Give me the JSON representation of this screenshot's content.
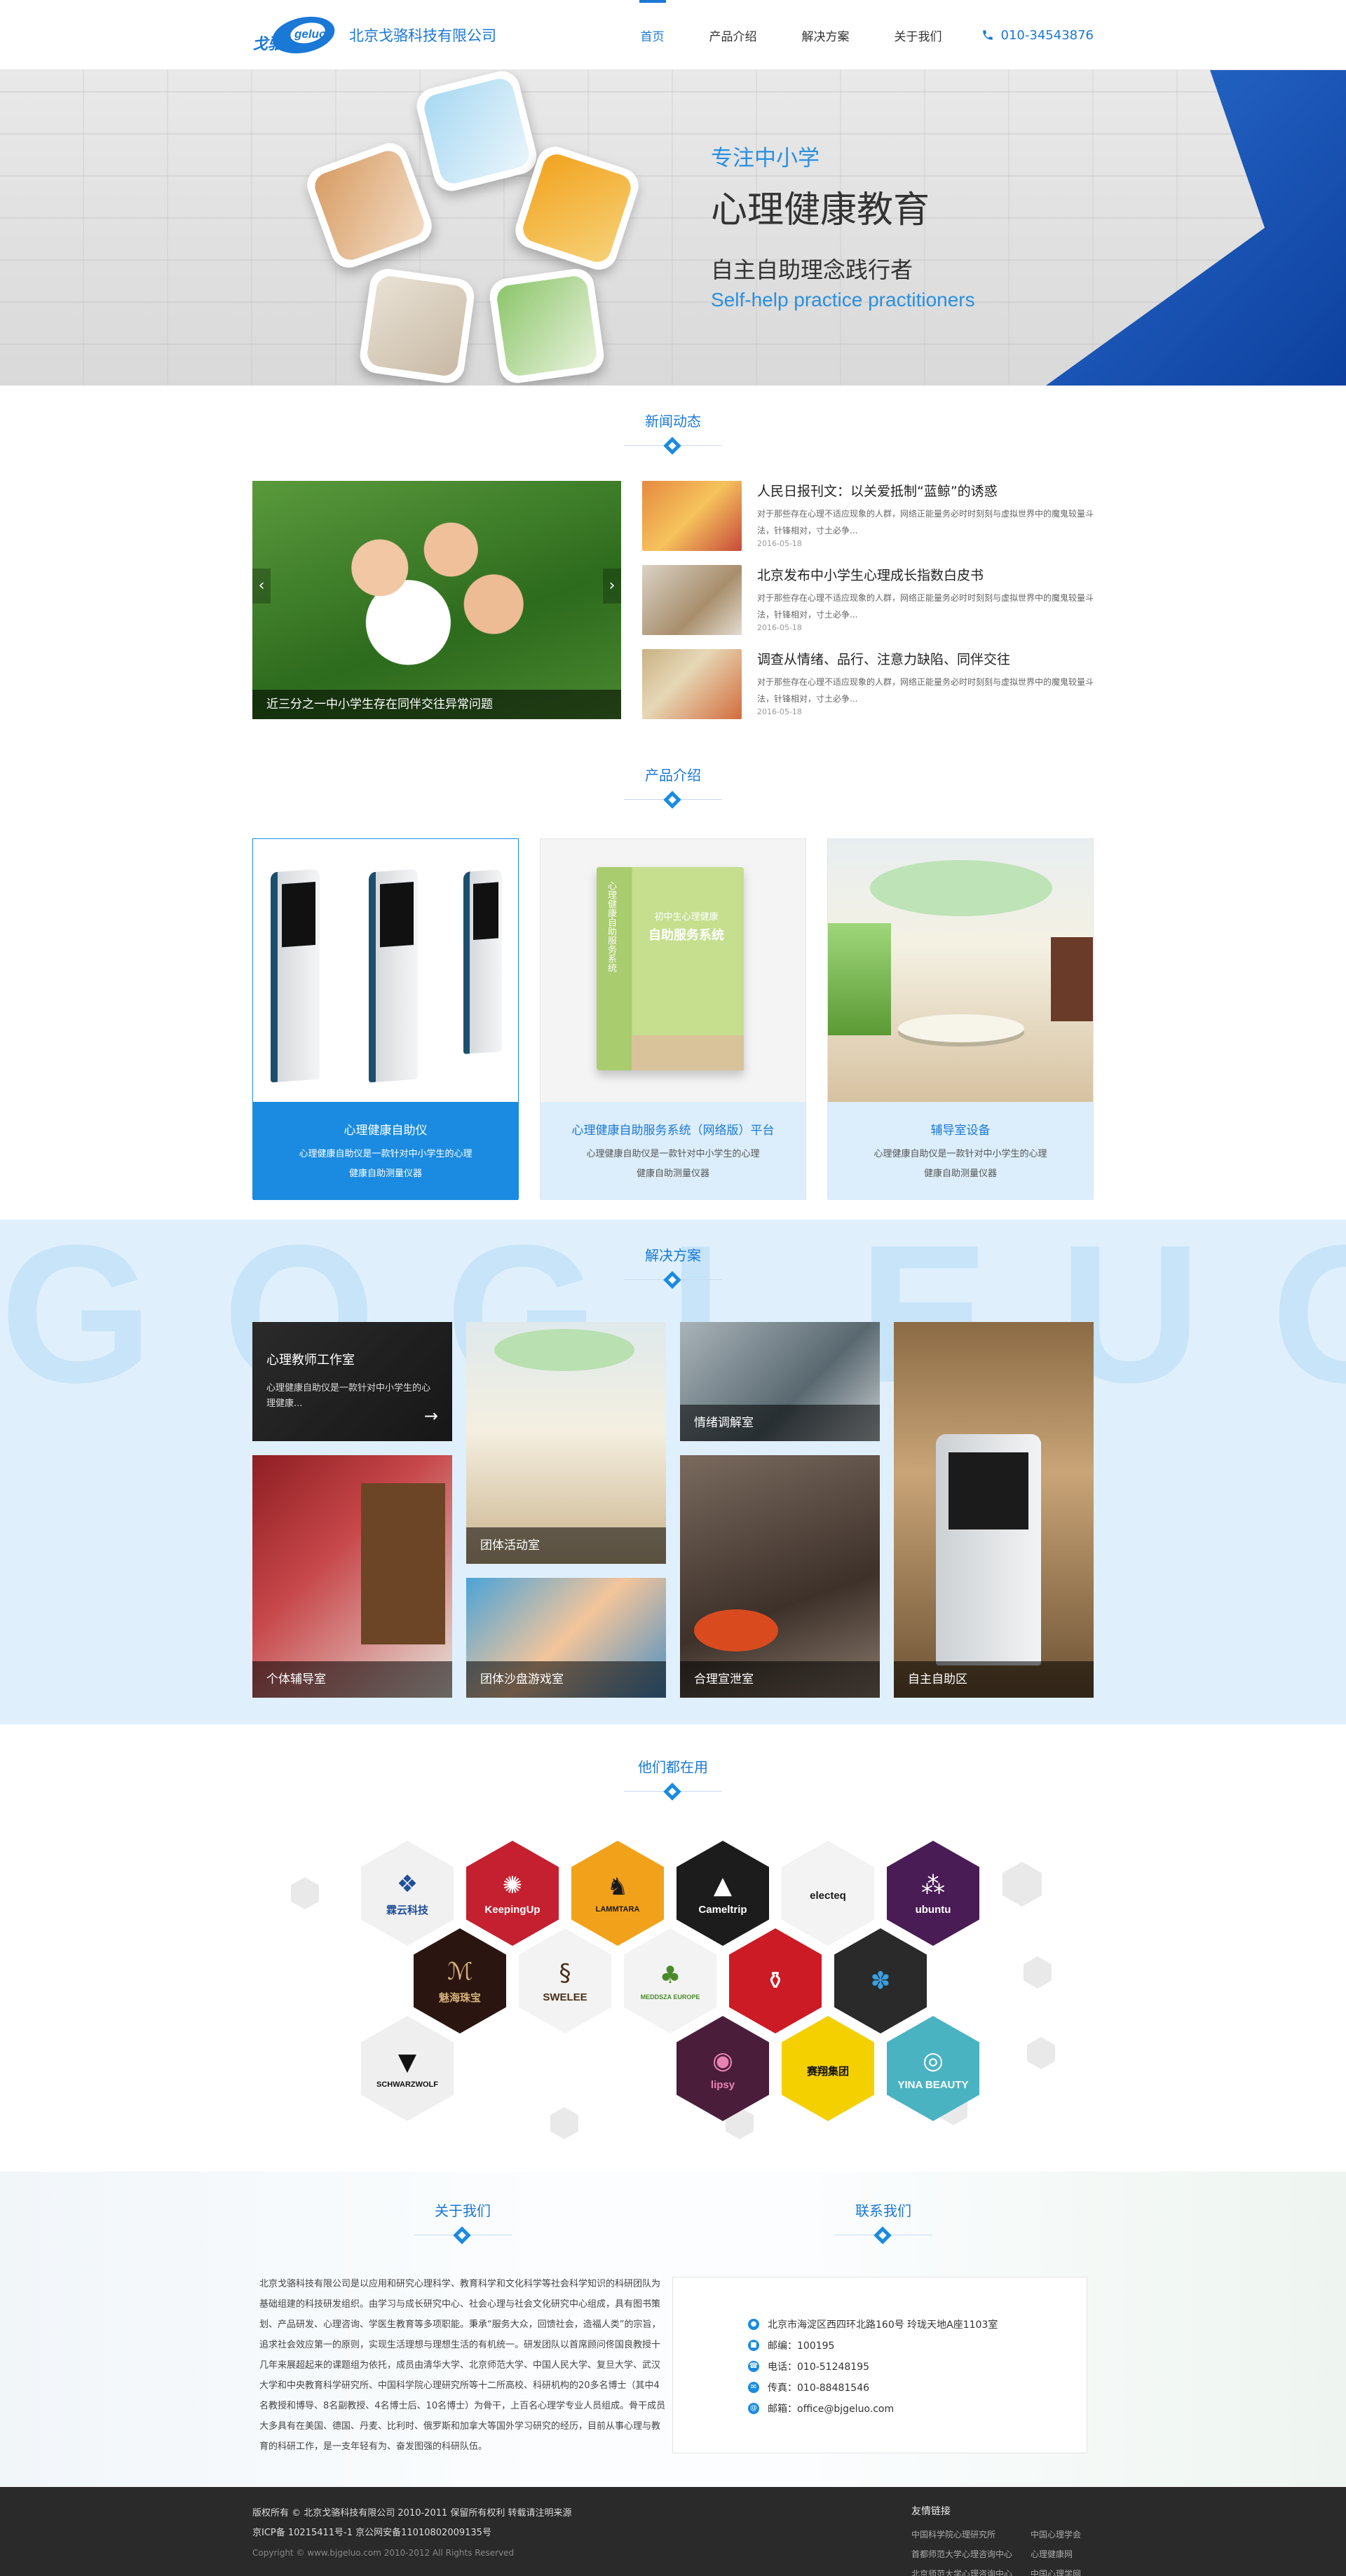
{
  "header": {
    "logo_text": "戈骆",
    "logo_latin": "geluo",
    "company": "北京戈骆科技有限公司",
    "nav": [
      "首页",
      "产品介绍",
      "解决方案",
      "关于我们"
    ],
    "phone": "010-34543876"
  },
  "banner": {
    "line1": "专注中小学",
    "line2": "心理健康教育",
    "line3": "自主自助理念践行者",
    "line4": "Self-help practice practitioners"
  },
  "news": {
    "title": "新闻动态",
    "slider_caption": "近三分之一中小学生存在同伴交往异常问题",
    "items": [
      {
        "title": "人民日报刊文：以关爱抵制“蓝鲸”的诱惑",
        "desc": "对于那些存在心理不适应现象的人群，网络正能量务必时时刻刻与虚拟世界中的魔鬼较量斗法，针锋相对，寸土必争...",
        "date": "2016-05-18"
      },
      {
        "title": "北京发布中小学生心理成长指数白皮书",
        "desc": "对于那些存在心理不适应现象的人群，网络正能量务必时时刻刻与虚拟世界中的魔鬼较量斗法，针锋相对，寸土必争...",
        "date": "2016-05-18"
      },
      {
        "title": "调查从情绪、品行、注意力缺陷、同伴交往",
        "desc": "对于那些存在心理不适应现象的人群，网络正能量务必时时刻刻与虚拟世界中的魔鬼较量斗法，针锋相对，寸土必争...",
        "date": "2016-05-18"
      }
    ]
  },
  "products": {
    "title": "产品介绍",
    "items": [
      {
        "name": "心理健康自助仪",
        "desc": "心理健康自助仪是一款针对中小学生的心理健康自助测量仪器"
      },
      {
        "name": "心理健康自助服务系统（网络版）平台",
        "desc": "心理健康自助仪是一款针对中小学生的心理健康自助测量仪器"
      },
      {
        "name": "辅导室设备",
        "desc": "心理健康自助仪是一款针对中小学生的心理健康自助测量仪器"
      }
    ],
    "box_title": "初中生心理健康",
    "box_sub": "自助服务系统",
    "box_side": "心理健康自助服务系统"
  },
  "solutions": {
    "title": "解决方案",
    "bg_letters": "GOGLEUO",
    "feature": {
      "name": "心理教师工作室",
      "desc": "心理健康自助仪是一款针对中小学生的心理健康..."
    },
    "labels": [
      "情绪调解室",
      "团体活动室",
      "个体辅导室",
      "团体沙盘游戏室",
      "合理宣泄室",
      "自主自助区"
    ]
  },
  "clients": {
    "title": "他们都在用",
    "brands": [
      "霖云科技",
      "KeepingUp",
      "LAMMTARA",
      "Cameltrip",
      "electeq",
      "ubuntu",
      "魅海珠宝",
      "SWELEE",
      "MEDDSZA EUROPE",
      "",
      "",
      "SCHWARZWOLF",
      "lipsy",
      "赛翔集团",
      "YINA BEAUTY"
    ]
  },
  "about": {
    "title": "关于我们",
    "text": "北京戈骆科技有限公司是以应用和研究心理科学、教育科学和文化科学等社会科学知识的科研团队为基础组建的科技研发组织。由学习与成长研究中心、社会心理与社会文化研究中心组成，具有图书策划、产品研发、心理咨询、学医生教育等多项职能。秉承“服务大众，回馈社会，造福人类”的宗旨，追求社会效应第一的原则，实现生活理想与理想生活的有机统一。研发团队以首席顾问佟国良教授十几年来展超起来的课题组为依托，成员由清华大学、北京师范大学、中国人民大学、复旦大学、武汉大学和中央教育科学研究所、中国科学院心理研究所等十二所高校、科研机构的20多名博士（其中4名教授和博导、8名副教授、4名博士后、10名博士）为骨干，上百名心理学专业人员组成。骨干成员大多具有在美国、德国、丹麦、比利时、俄罗斯和加拿大等国外学习研究的经历，目前从事心理与教育的科研工作，是一支年轻有为、奋发图强的科研队伍。"
  },
  "contact": {
    "title": "联系我们",
    "address": "北京市海淀区西四环北路160号 玲珑天地A座1103室",
    "zip": "邮编：100195",
    "tel": "电话：010-51248195",
    "fax": "传真：010-88481546",
    "email": "邮箱：office@bjgeluo.com"
  },
  "footer": {
    "line1": "版权所有 © 北京戈骆科技有限公司 2010-2011   保留所有权利   转载请注明来源",
    "line2": "京ICP备 10215411号-1    京公网安备11010802009135号",
    "line3": "Copyright © www.bjgeluo.com 2010-2012   All Rights Reserved",
    "links_title": "友情链接",
    "links": [
      "中国科学院心理研究所",
      "中国心理学会",
      "首都师范大学心理咨询中心",
      "心理健康网",
      "北京师范大学心理咨询中心",
      "中国心理学网"
    ]
  },
  "colors": {
    "primary": "#1a78d6",
    "accent": "#1a8be0",
    "light": "#dff0fc",
    "footer": "#2a2a2a"
  }
}
